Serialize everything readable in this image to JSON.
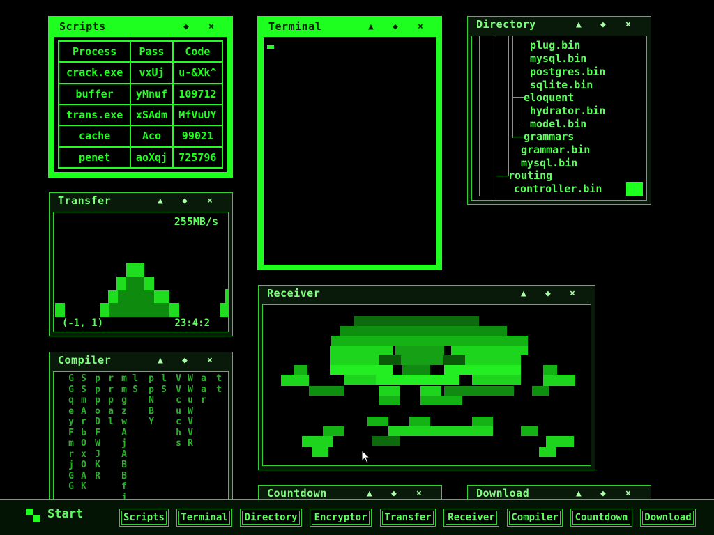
{
  "colors": {
    "accent": "#1fff1f",
    "dim": "#2fd12f",
    "background": "#000000"
  },
  "icons": {
    "minimize": "▲",
    "move": "◆",
    "close": "×"
  },
  "scripts": {
    "title": "Scripts",
    "headers": [
      "Process",
      "Pass",
      "Code"
    ],
    "rows": [
      [
        "crack.exe",
        "vxUj",
        "u-&Xk^"
      ],
      [
        "buffer",
        "yMnuf",
        "109712"
      ],
      [
        "trans.exe",
        "xSAdm",
        "MfVuUY"
      ],
      [
        "cache",
        "Aco",
        "99021"
      ],
      [
        "penet",
        "aoXqj",
        "725796"
      ]
    ]
  },
  "terminal": {
    "title": "Terminal"
  },
  "directory": {
    "title": "Directory",
    "items": [
      "plug.bin",
      "mysql.bin",
      "postgres.bin",
      "sqlite.bin",
      "eloquent",
      "hydrator.bin",
      "model.bin",
      "grammars",
      "grammar.bin",
      "mysql.bin",
      "routing",
      "controller.bin"
    ]
  },
  "transfer": {
    "title": "Transfer",
    "rate": "255MB/s",
    "coords": "(-1, 1)",
    "timer": "23:4:2"
  },
  "compiler": {
    "title": "Compiler",
    "columns": [
      "GGqeyFmrjGG",
      "SSmArbOxOAK",
      "pppoDFWJKR",
      "rrpal",
      "mmgzwAjABBfj",
      "lS",
      "ppNBY",
      "lS",
      "VVcuchs",
      "WWuWVVR",
      "aar",
      "tt"
    ]
  },
  "receiver": {
    "title": "Receiver"
  },
  "countdown": {
    "title": "Countdown"
  },
  "download": {
    "title": "Download"
  },
  "taskbar": {
    "start_label": "Start",
    "buttons": [
      "Scripts",
      "Terminal",
      "Directory",
      "Encryptor",
      "Transfer",
      "Receiver",
      "Compiler",
      "Countdown",
      "Download"
    ]
  }
}
